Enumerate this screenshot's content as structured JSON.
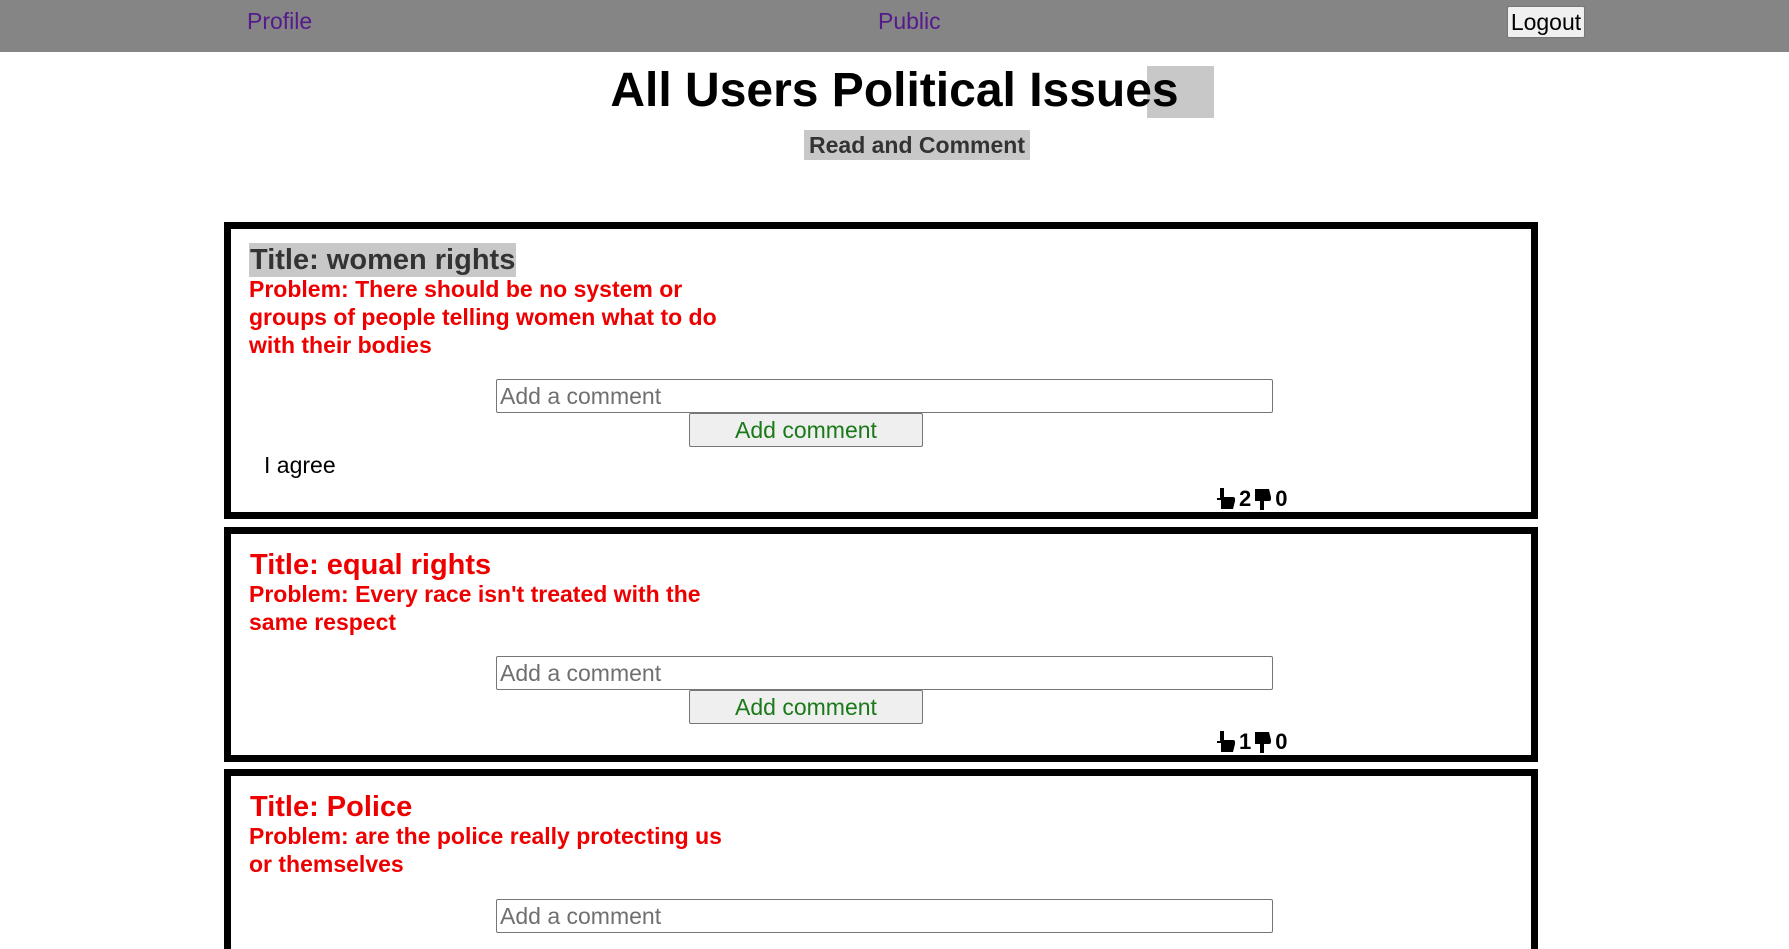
{
  "nav": {
    "profile": "Profile",
    "public": "Public",
    "logout": "Logout"
  },
  "header": {
    "title": "All Users Political Issues",
    "subtitle": "Read and Comment"
  },
  "issues": [
    {
      "title": "Title: women rights",
      "problem": "Problem: There should be no system or groups of people telling women what to do with their bodies",
      "comment_placeholder": "Add a comment",
      "add_label": "Add comment",
      "comments": [
        {
          "text": "I agree",
          "likes": "2",
          "dislikes": "0"
        }
      ]
    },
    {
      "title": "Title: equal rights",
      "problem": "Problem: Every race isn't treated with the same respect",
      "comment_placeholder": "Add a comment",
      "add_label": "Add comment",
      "comments": [
        {
          "text": "",
          "likes": "1",
          "dislikes": "0"
        }
      ]
    },
    {
      "title": "Title: Police",
      "problem": "Problem: are the police really protecting us or themselves",
      "comment_placeholder": "Add a comment"
    }
  ],
  "icons": {
    "like": "thumbs-up-icon",
    "dislike": "thumbs-down-icon"
  },
  "colors": {
    "navbar": "#858585",
    "link": "#551a8b",
    "problem": "#ee0000",
    "button_text": "#1a7a1a",
    "highlight": "#c8c8c8"
  }
}
